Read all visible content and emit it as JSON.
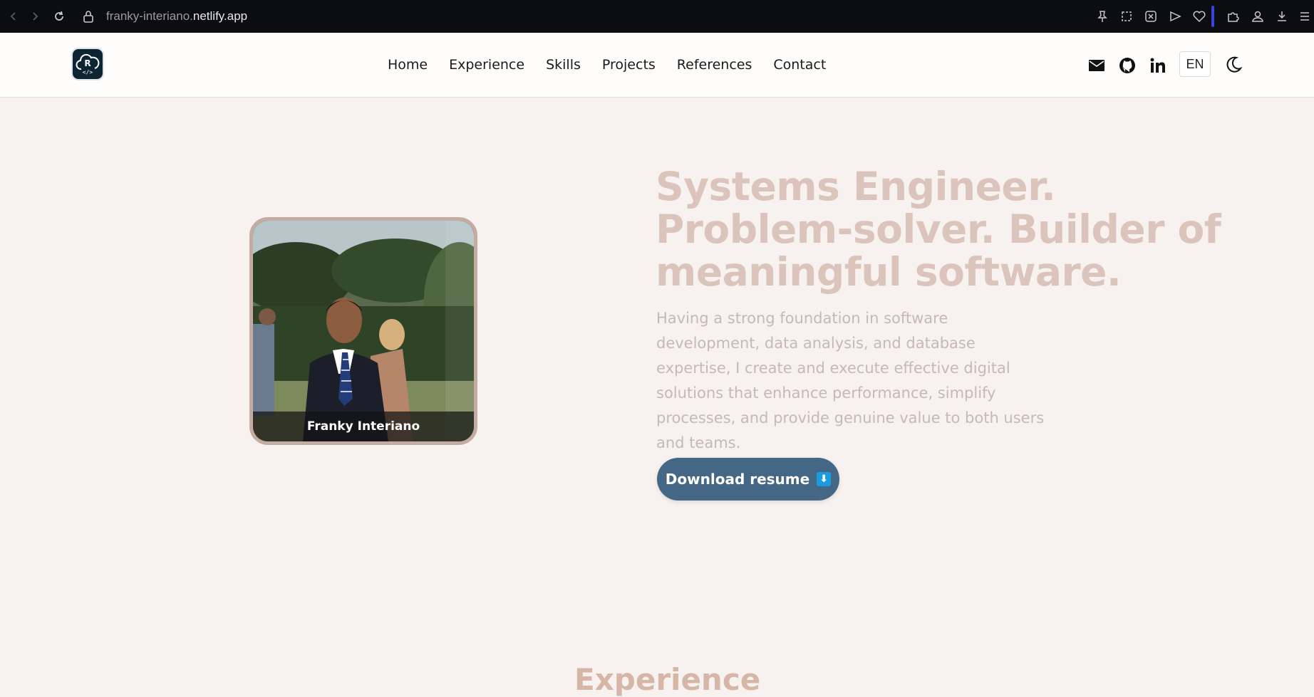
{
  "browser": {
    "url_prefix": "franky-interiano.",
    "url_domain": "netlify.app",
    "icons": [
      "back-icon",
      "forward-icon",
      "reload-icon",
      "lock-icon",
      "pin-icon",
      "screenshot-icon",
      "block-icon",
      "send-icon",
      "heart-icon",
      "extensions-icon",
      "profile-icon",
      "download-icon",
      "menu-icon"
    ]
  },
  "header": {
    "nav": [
      "Home",
      "Experience",
      "Skills",
      "Projects",
      "References",
      "Contact"
    ],
    "lang": "EN"
  },
  "hero": {
    "photo_caption": "Franky Interiano",
    "title": "Systems Engineer. Problem-solver. Builder of meaningful software.",
    "description": "Having a strong foundation in software development, data analysis, and database expertise, I create and execute effective digital solutions that enhance performance, simplify processes, and provide genuine value to both users and teams.",
    "download_label": "Download resume",
    "download_icon": "⬇"
  },
  "sections": {
    "experience_title": "Experience"
  },
  "colors": {
    "accent": "#456786",
    "title": "#dbc4bb",
    "background": "#f7f2ef"
  }
}
